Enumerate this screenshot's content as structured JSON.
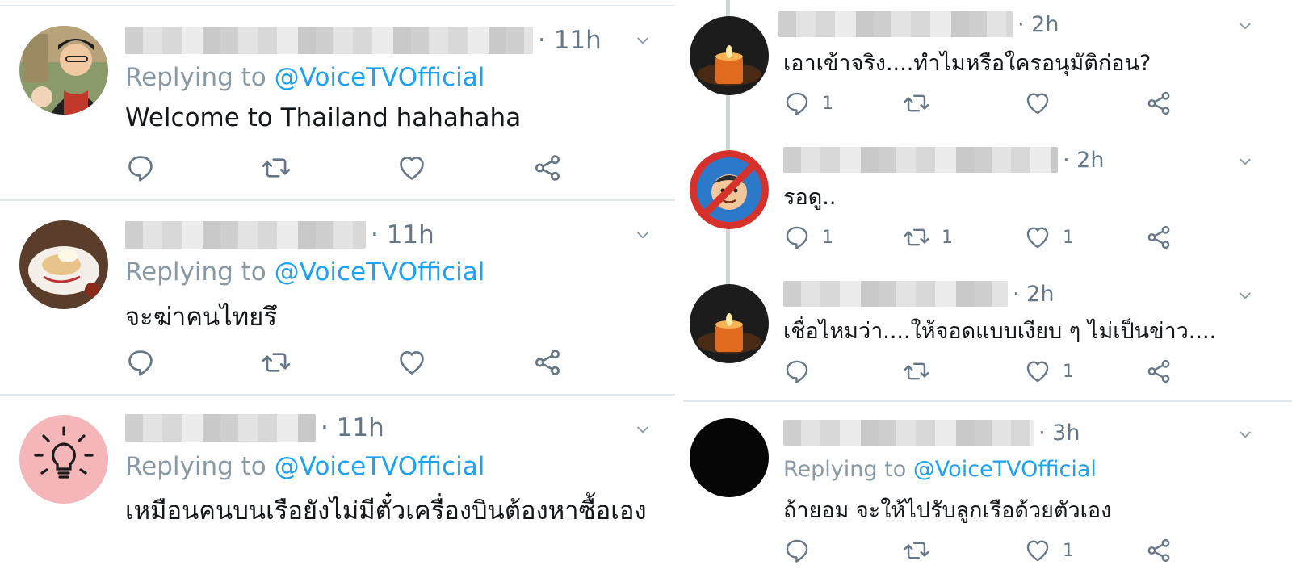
{
  "reply_label": "Replying to",
  "left_column": {
    "tweets": [
      {
        "time": "· 11h",
        "replying_to": "@VoiceTVOfficial",
        "text": "Welcome to Thailand hahahaha"
      },
      {
        "time": "· 11h",
        "replying_to": "@VoiceTVOfficial",
        "text": "จะฆ่าคนไทยรึ"
      },
      {
        "time": "· 11h",
        "replying_to": "@VoiceTVOfficial",
        "text": "เหมือนคนบนเรือยังไม่มีตั๋วเครื่องบินต้องหาซื้อเอง"
      }
    ]
  },
  "right_column": {
    "tweets": [
      {
        "time": "· 2h",
        "text": "เอาเข้าจริง....ทำไมหรือใครอนุมัติก่อน?",
        "counts": {
          "reply": "1",
          "retweet": "",
          "like": ""
        }
      },
      {
        "time": "· 2h",
        "text": "รอดู..",
        "counts": {
          "reply": "1",
          "retweet": "1",
          "like": "1"
        }
      },
      {
        "time": "· 2h",
        "text": "เชื่อไหมว่า....ให้จอดแบบเงียบ ๆ ไม่เป็นข่าว....",
        "counts": {
          "reply": "",
          "retweet": "",
          "like": "1"
        }
      },
      {
        "time": "· 3h",
        "replying_to": "@VoiceTVOfficial",
        "text": "ถ้ายอม จะให้ไปรับลูกเรือด้วยตัวเอง",
        "counts": {
          "reply": "",
          "retweet": "",
          "like": "1"
        }
      }
    ]
  },
  "icons": {
    "reply": "reply-icon",
    "retweet": "retweet-icon",
    "like": "like-icon",
    "share": "share-icon",
    "more": "chevron-down-icon"
  },
  "colors": {
    "link": "#1da1f2",
    "muted": "#657786",
    "text": "#14171a",
    "divider": "#e1e8ed"
  }
}
